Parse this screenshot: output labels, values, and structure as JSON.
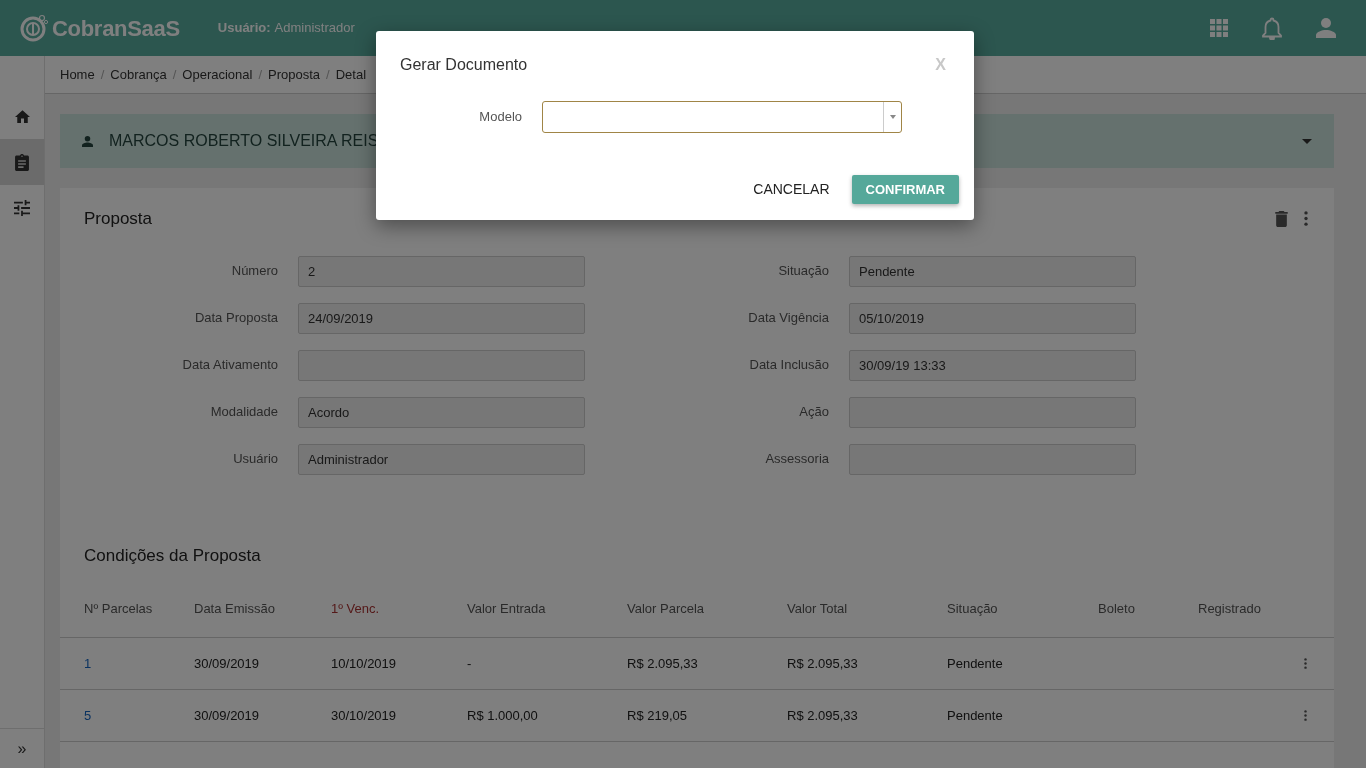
{
  "header": {
    "logo": "CobranSaaS",
    "user_label": "Usuário:",
    "user": "Administrador"
  },
  "sidebar": {
    "items": [
      {
        "selected": false
      },
      {
        "selected": true
      },
      {
        "selected": false
      }
    ],
    "expand": "»"
  },
  "breadcrumb": {
    "separator": "/",
    "items": [
      "Home",
      "Cobrança",
      "Operacional",
      "Proposta",
      "Detal"
    ]
  },
  "customer": {
    "name": "MARCOS ROBERTO SILVEIRA REIS"
  },
  "proposal": {
    "title": "Proposta",
    "fields": [
      {
        "label": "Número",
        "value": "2"
      },
      {
        "label": "Situação",
        "value": "Pendente"
      },
      {
        "label": "Data Proposta",
        "value": "24/09/2019"
      },
      {
        "label": "Data Vigência",
        "value": "05/10/2019"
      },
      {
        "label": "Data Ativamento"
      },
      {
        "label": "Data Inclusão",
        "value": "30/09/19 13:33"
      },
      {
        "label": "Modalidade",
        "value": "Acordo"
      },
      {
        "label": "Ação"
      },
      {
        "label": "Usuário",
        "value": "Administrador"
      },
      {
        "label": "Assessoria"
      }
    ]
  },
  "conditions": {
    "title": "Condições da Proposta",
    "columns": [
      {
        "label": "Nº Parcelas",
        "sorted": false
      },
      {
        "label": "Data Emissão",
        "sorted": false
      },
      {
        "label": "1º Venc.",
        "sorted": true
      },
      {
        "label": "Valor Entrada",
        "sorted": false
      },
      {
        "label": "Valor Parcela",
        "sorted": false
      },
      {
        "label": "Valor Total",
        "sorted": false
      },
      {
        "label": "Situação",
        "sorted": false
      },
      {
        "label": "Boleto",
        "sorted": false
      },
      {
        "label": "Registrado",
        "sorted": false
      }
    ],
    "rows": [
      [
        "1",
        "30/09/2019",
        "10/10/2019",
        "-",
        "R$ 2.095,33",
        "R$ 2.095,33",
        "Pendente"
      ],
      [
        "5",
        "30/09/2019",
        "30/10/2019",
        "R$ 1.000,00",
        "R$ 219,05",
        "R$ 2.095,33",
        "Pendente"
      ]
    ]
  },
  "dialog": {
    "title": "Gerar Documento",
    "close": "X",
    "field_label": "Modelo",
    "buttons": [
      {
        "label": "CANCELAR",
        "kind": "flat"
      },
      {
        "label": "CONFIRMAR",
        "kind": "primary"
      }
    ]
  }
}
